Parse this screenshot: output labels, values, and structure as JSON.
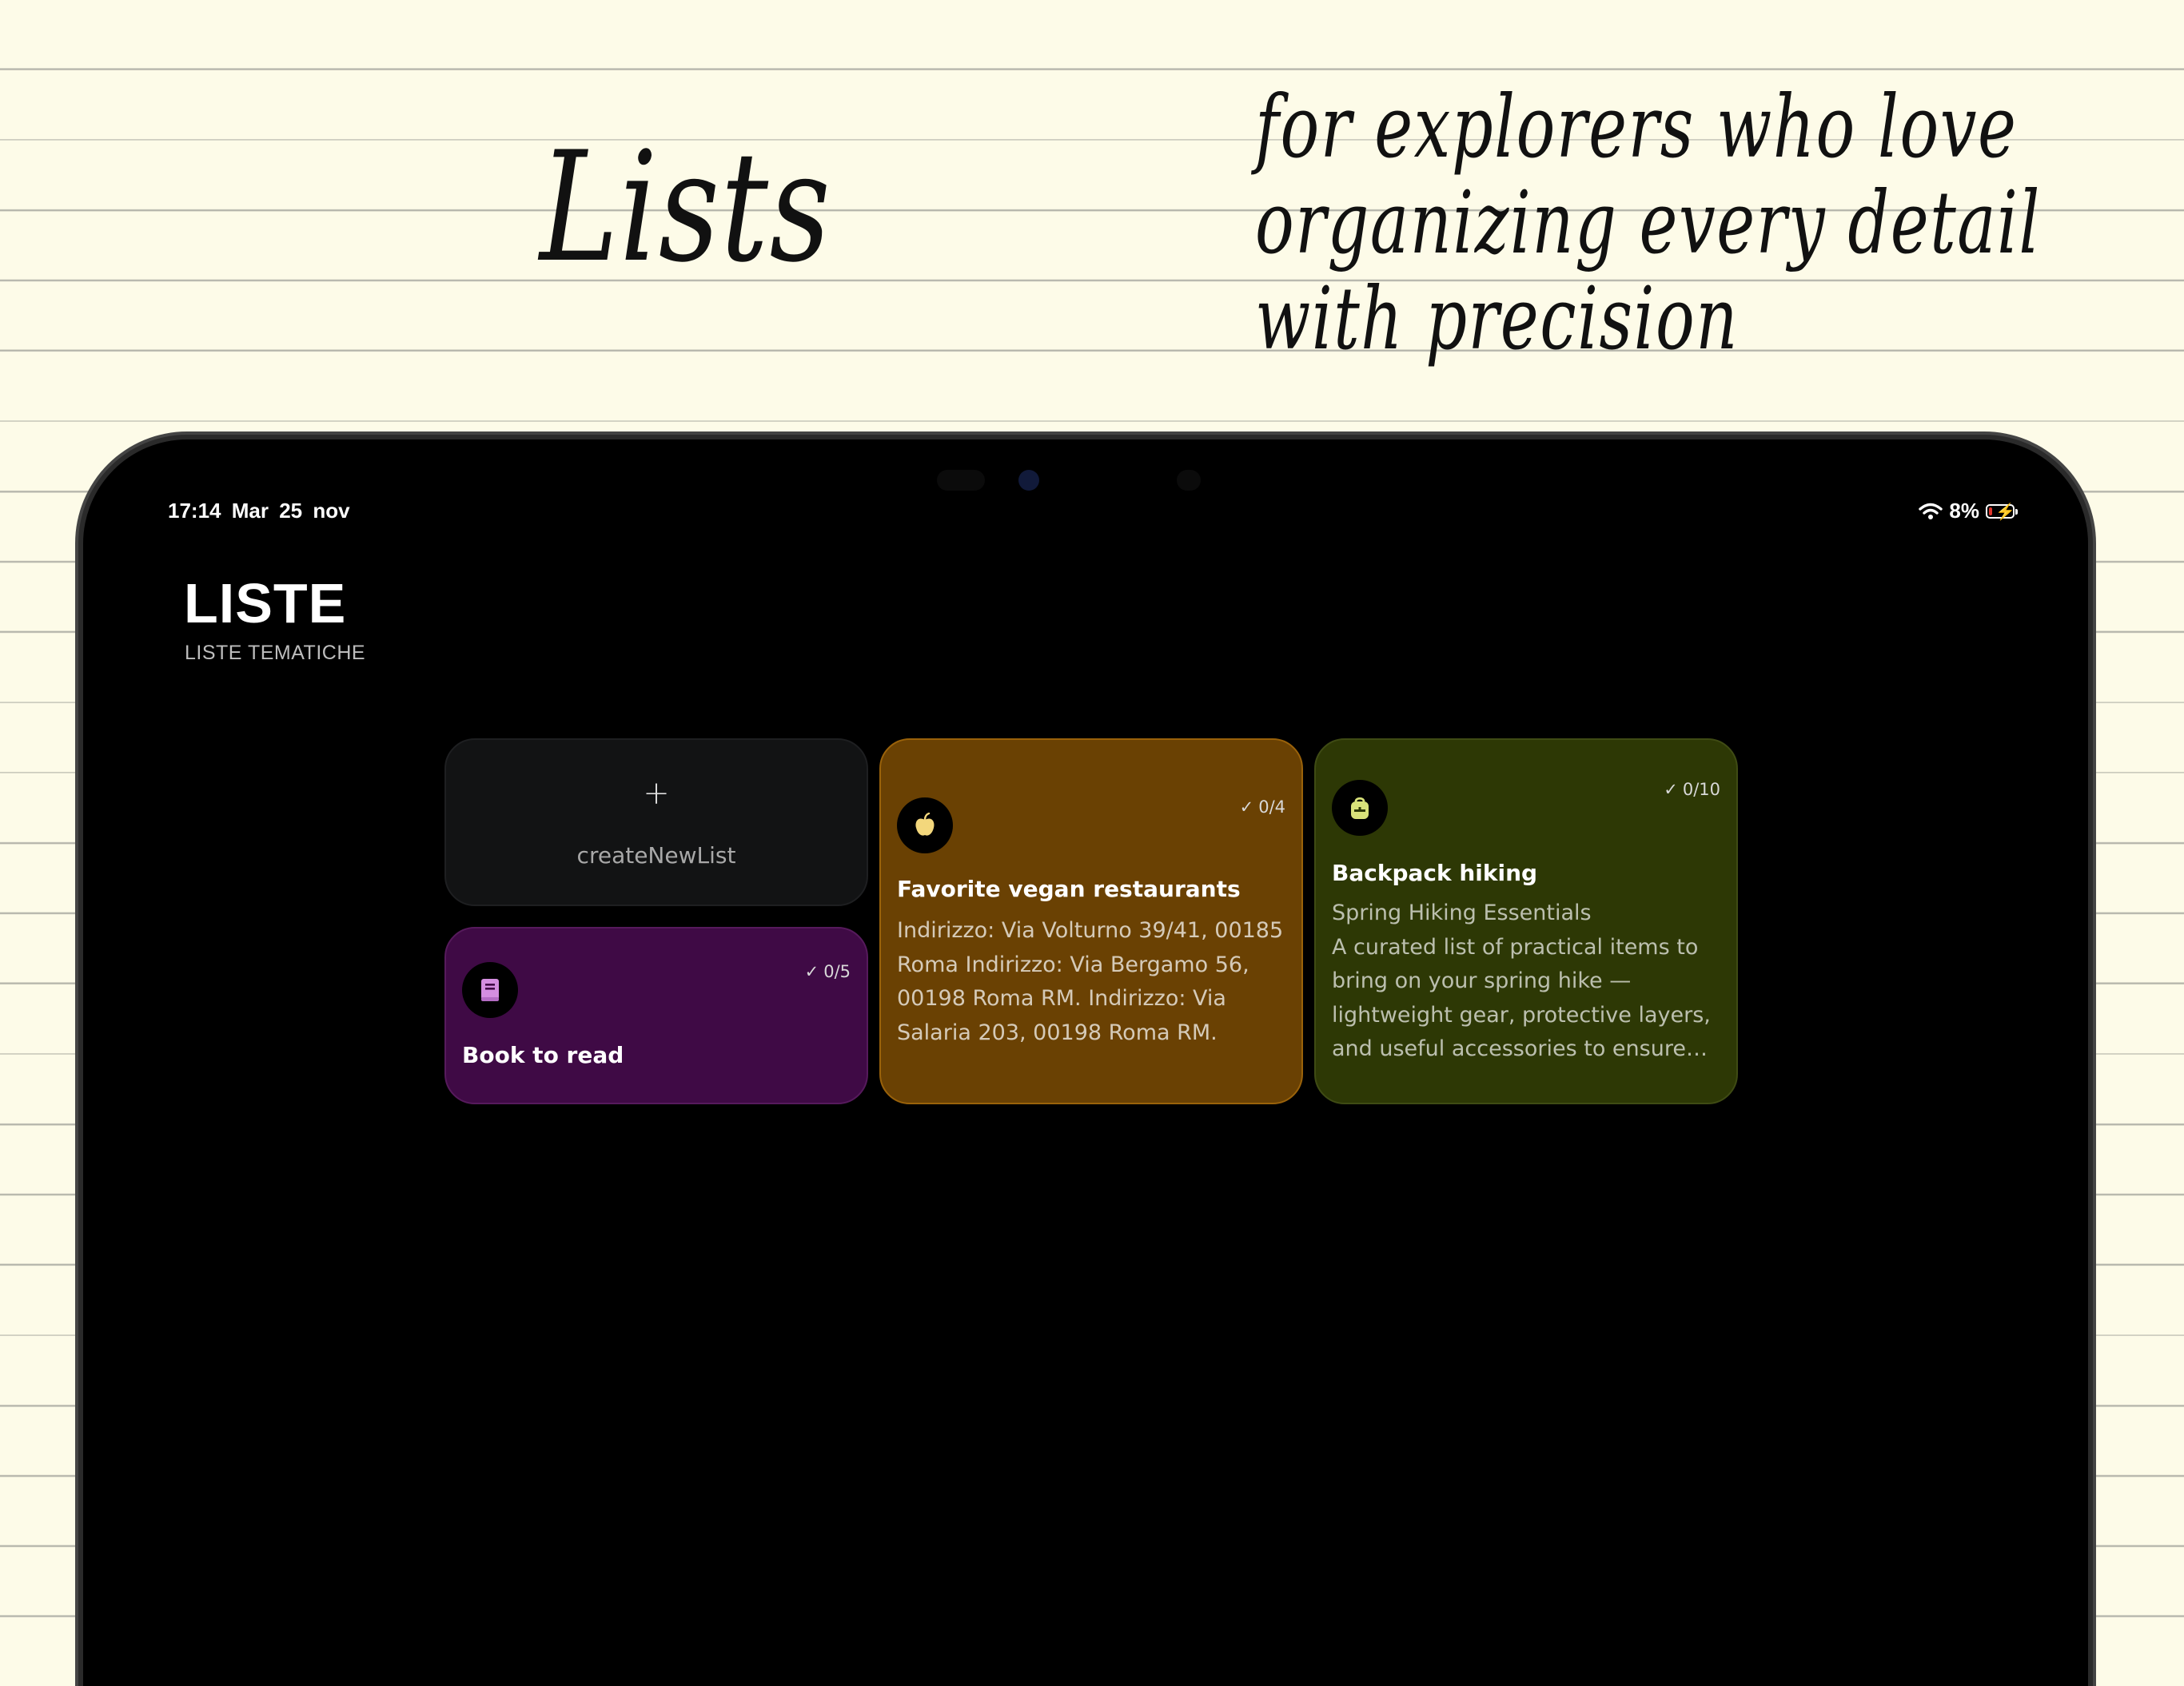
{
  "marketing": {
    "headline": "Lists",
    "tagline": "for explorers who love organizing every detail with precision"
  },
  "status_bar": {
    "time": "17:14",
    "date": "Mar 25 nov",
    "battery": "8%",
    "wifi_icon": "wifi-icon",
    "battery_icon": "battery-charging-icon"
  },
  "header": {
    "title": "LISTE",
    "subtitle": "LISTE TEMATICHE"
  },
  "create_card": {
    "icon": "+",
    "label": "createNewList"
  },
  "lists": [
    {
      "title": "Book to read",
      "count": "0/5",
      "icon": "book-icon",
      "color": "#3f0a45",
      "icon_color": "#d48ee0",
      "description": ""
    },
    {
      "title": "Favorite vegan restaurants",
      "count": "0/4",
      "icon": "apple-icon",
      "color": "#6a4103",
      "icon_color": "#f3d77c",
      "description": "Indirizzo: Via Volturno 39/41, 00185 Roma Indirizzo: Via Bergamo 56, 00198 Roma RM. Indirizzo: Via Salaria 203, 00198 Roma RM."
    },
    {
      "title": "Backpack hiking",
      "count": "0/10",
      "icon": "backpack-icon",
      "color": "#2d3805",
      "icon_color": "#d9e27a",
      "description": "Spring Hiking Essentials\nA curated list of practical items to bring on your spring hike — lightweight gear, protective layers, and useful accessories to ensure co..."
    }
  ]
}
